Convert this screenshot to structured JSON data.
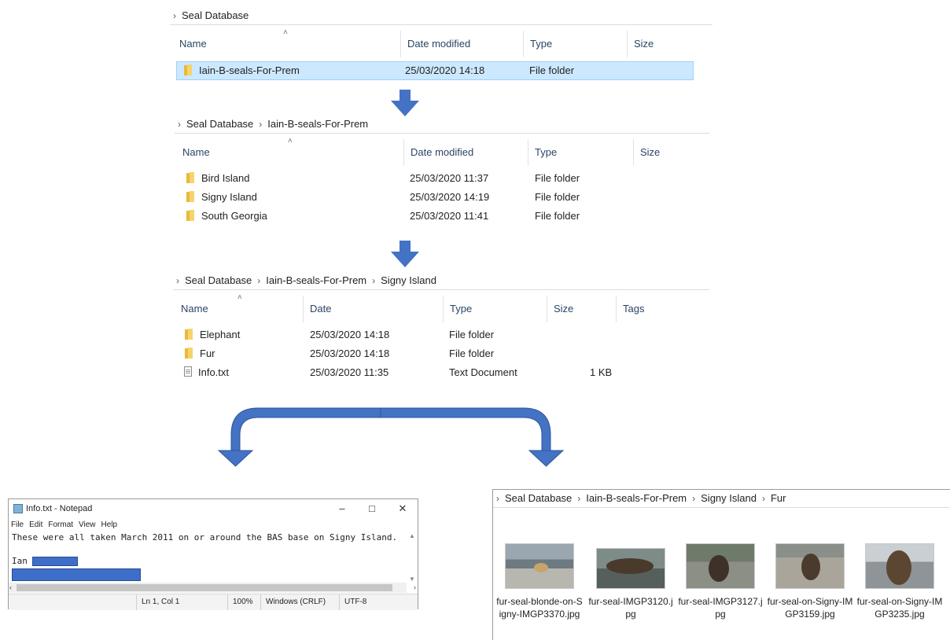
{
  "explorer1": {
    "breadcrumb": [
      "Seal Database"
    ],
    "columns": [
      "Name",
      "Date modified",
      "Type",
      "Size"
    ],
    "rows": [
      {
        "name": "Iain-B-seals-For-Prem",
        "date": "25/03/2020 14:18",
        "type": "File folder",
        "icon": "folder-icon",
        "selected": true
      }
    ]
  },
  "explorer2": {
    "breadcrumb": [
      "Seal Database",
      "Iain-B-seals-For-Prem"
    ],
    "columns": [
      "Name",
      "Date modified",
      "Type",
      "Size"
    ],
    "rows": [
      {
        "name": "Bird Island",
        "date": "25/03/2020 11:37",
        "type": "File folder",
        "icon": "folder-icon"
      },
      {
        "name": "Signy Island",
        "date": "25/03/2020 14:19",
        "type": "File folder",
        "icon": "folder-icon"
      },
      {
        "name": "South Georgia",
        "date": "25/03/2020 11:41",
        "type": "File folder",
        "icon": "folder-icon"
      }
    ]
  },
  "explorer3": {
    "breadcrumb": [
      "Seal Database",
      "Iain-B-seals-For-Prem",
      "Signy Island"
    ],
    "columns": [
      "Name",
      "Date",
      "Type",
      "Size",
      "Tags"
    ],
    "rows": [
      {
        "name": "Elephant",
        "date": "25/03/2020 14:18",
        "type": "File folder",
        "size": "",
        "icon": "folder-icon"
      },
      {
        "name": "Fur",
        "date": "25/03/2020 14:18",
        "type": "File folder",
        "size": "",
        "icon": "folder-icon"
      },
      {
        "name": "Info.txt",
        "date": "25/03/2020 11:35",
        "type": "Text Document",
        "size": "1 KB",
        "icon": "text-file-icon"
      }
    ]
  },
  "notepad": {
    "title": "Info.txt - Notepad",
    "menu": [
      "File",
      "Edit",
      "Format",
      "View",
      "Help"
    ],
    "lines": [
      "These were all taken March 2011 on or around the BAS base on Signy Island.",
      "",
      "Ian"
    ],
    "status": {
      "position": "Ln 1, Col 1",
      "zoom": "100%",
      "line_ending": "Windows (CRLF)",
      "encoding": "UTF-8"
    }
  },
  "fur_folder": {
    "breadcrumb": [
      "Seal Database",
      "Iain-B-seals-For-Prem",
      "Signy Island",
      "Fur"
    ],
    "files": [
      {
        "name": "fur-seal-blonde-on-Signy-IMGP3370.jpg"
      },
      {
        "name": "fur-seal-IMGP3120.jpg"
      },
      {
        "name": "fur-seal-IMGP3127.jpg"
      },
      {
        "name": "fur-seal-on-Signy-IMGP3159.jpg"
      },
      {
        "name": "fur-seal-on-Signy-IMGP3235.jpg"
      }
    ]
  },
  "colors": {
    "selection": "#cce8ff",
    "arrow": "#4472c4",
    "redaction": "#3d6ec9"
  }
}
